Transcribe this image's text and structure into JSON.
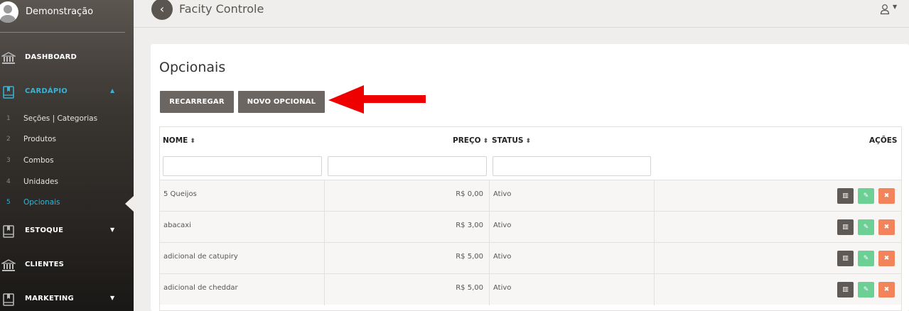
{
  "sidebar": {
    "user_name": "Demonstração",
    "items": [
      {
        "label": "DASHBOARD",
        "icon": "bank-icon"
      },
      {
        "label": "CARDÁPIO",
        "icon": "book-icon",
        "active": true
      },
      {
        "label": "ESTOQUE",
        "icon": "book-icon"
      },
      {
        "label": "CLIENTES",
        "icon": "bank-icon"
      },
      {
        "label": "MARKETING",
        "icon": "book-icon"
      }
    ],
    "subitems": [
      {
        "num": "1",
        "label": "Seções | Categorias"
      },
      {
        "num": "2",
        "label": "Produtos"
      },
      {
        "num": "3",
        "label": "Combos"
      },
      {
        "num": "4",
        "label": "Unidades"
      },
      {
        "num": "5",
        "label": "Opcionais"
      }
    ],
    "caret_up": "▲",
    "caret_down": "▼"
  },
  "topbar": {
    "back_glyph": "‹",
    "title": "Facity Controle",
    "user_caret": "▼"
  },
  "page": {
    "title": "Opcionais",
    "buttons": {
      "reload": "RECARREGAR",
      "new": "NOVO OPCIONAL"
    }
  },
  "table": {
    "headers": {
      "name": "NOME",
      "price": "PREÇO",
      "status": "STATUS",
      "actions": "AÇÕES"
    },
    "sort_glyph": "⬍",
    "rows": [
      {
        "name": "5 Queijos",
        "price": "R$ 0,00",
        "status": "Ativo"
      },
      {
        "name": "abacaxi",
        "price": "R$ 3,00",
        "status": "Ativo"
      },
      {
        "name": "adicional de catupiry",
        "price": "R$ 5,00",
        "status": "Ativo"
      },
      {
        "name": "adicional de cheddar",
        "price": "R$ 5,00",
        "status": "Ativo"
      }
    ],
    "action_glyphs": {
      "view": "▥",
      "edit": "✎",
      "delete": "✖"
    }
  },
  "colors": {
    "accent": "#3ab2d6",
    "button": "#6b6661",
    "edit": "#6cd095",
    "delete": "#f2845b",
    "arrow": "#ee0000"
  }
}
